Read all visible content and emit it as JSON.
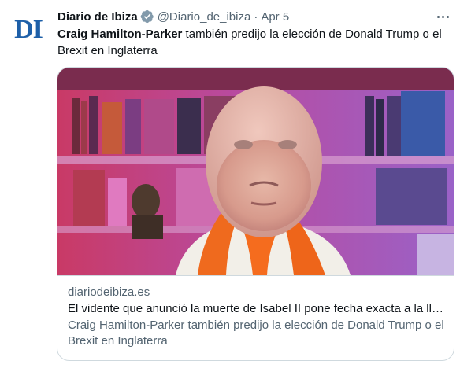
{
  "account": {
    "avatar_text": "DI",
    "display_name": "Diario de Ibiza",
    "handle": "@Diario_de_ibiza",
    "separator": "·",
    "timestamp": "Apr 5",
    "verified_badge_color": "#829aab"
  },
  "tweet": {
    "text_bold": "Craig Hamilton-Parker",
    "text_rest": " también predijo la elección de Donald Trump o el Brexit en Inglaterra"
  },
  "card": {
    "media_icon": "video-thumbnail",
    "domain": "diariodeibiza.es",
    "title": "El vidente que anunció la muerte de Isabel II pone fecha exacta a la llegada del fin del mundo",
    "description": "Craig Hamilton-Parker también predijo la elección de Donald Trump o el Brexit en Inglaterra"
  },
  "colors": {
    "text": "#0f1419",
    "secondary": "#536471",
    "border": "#cfd9de",
    "brand": "#1d5fa8"
  }
}
